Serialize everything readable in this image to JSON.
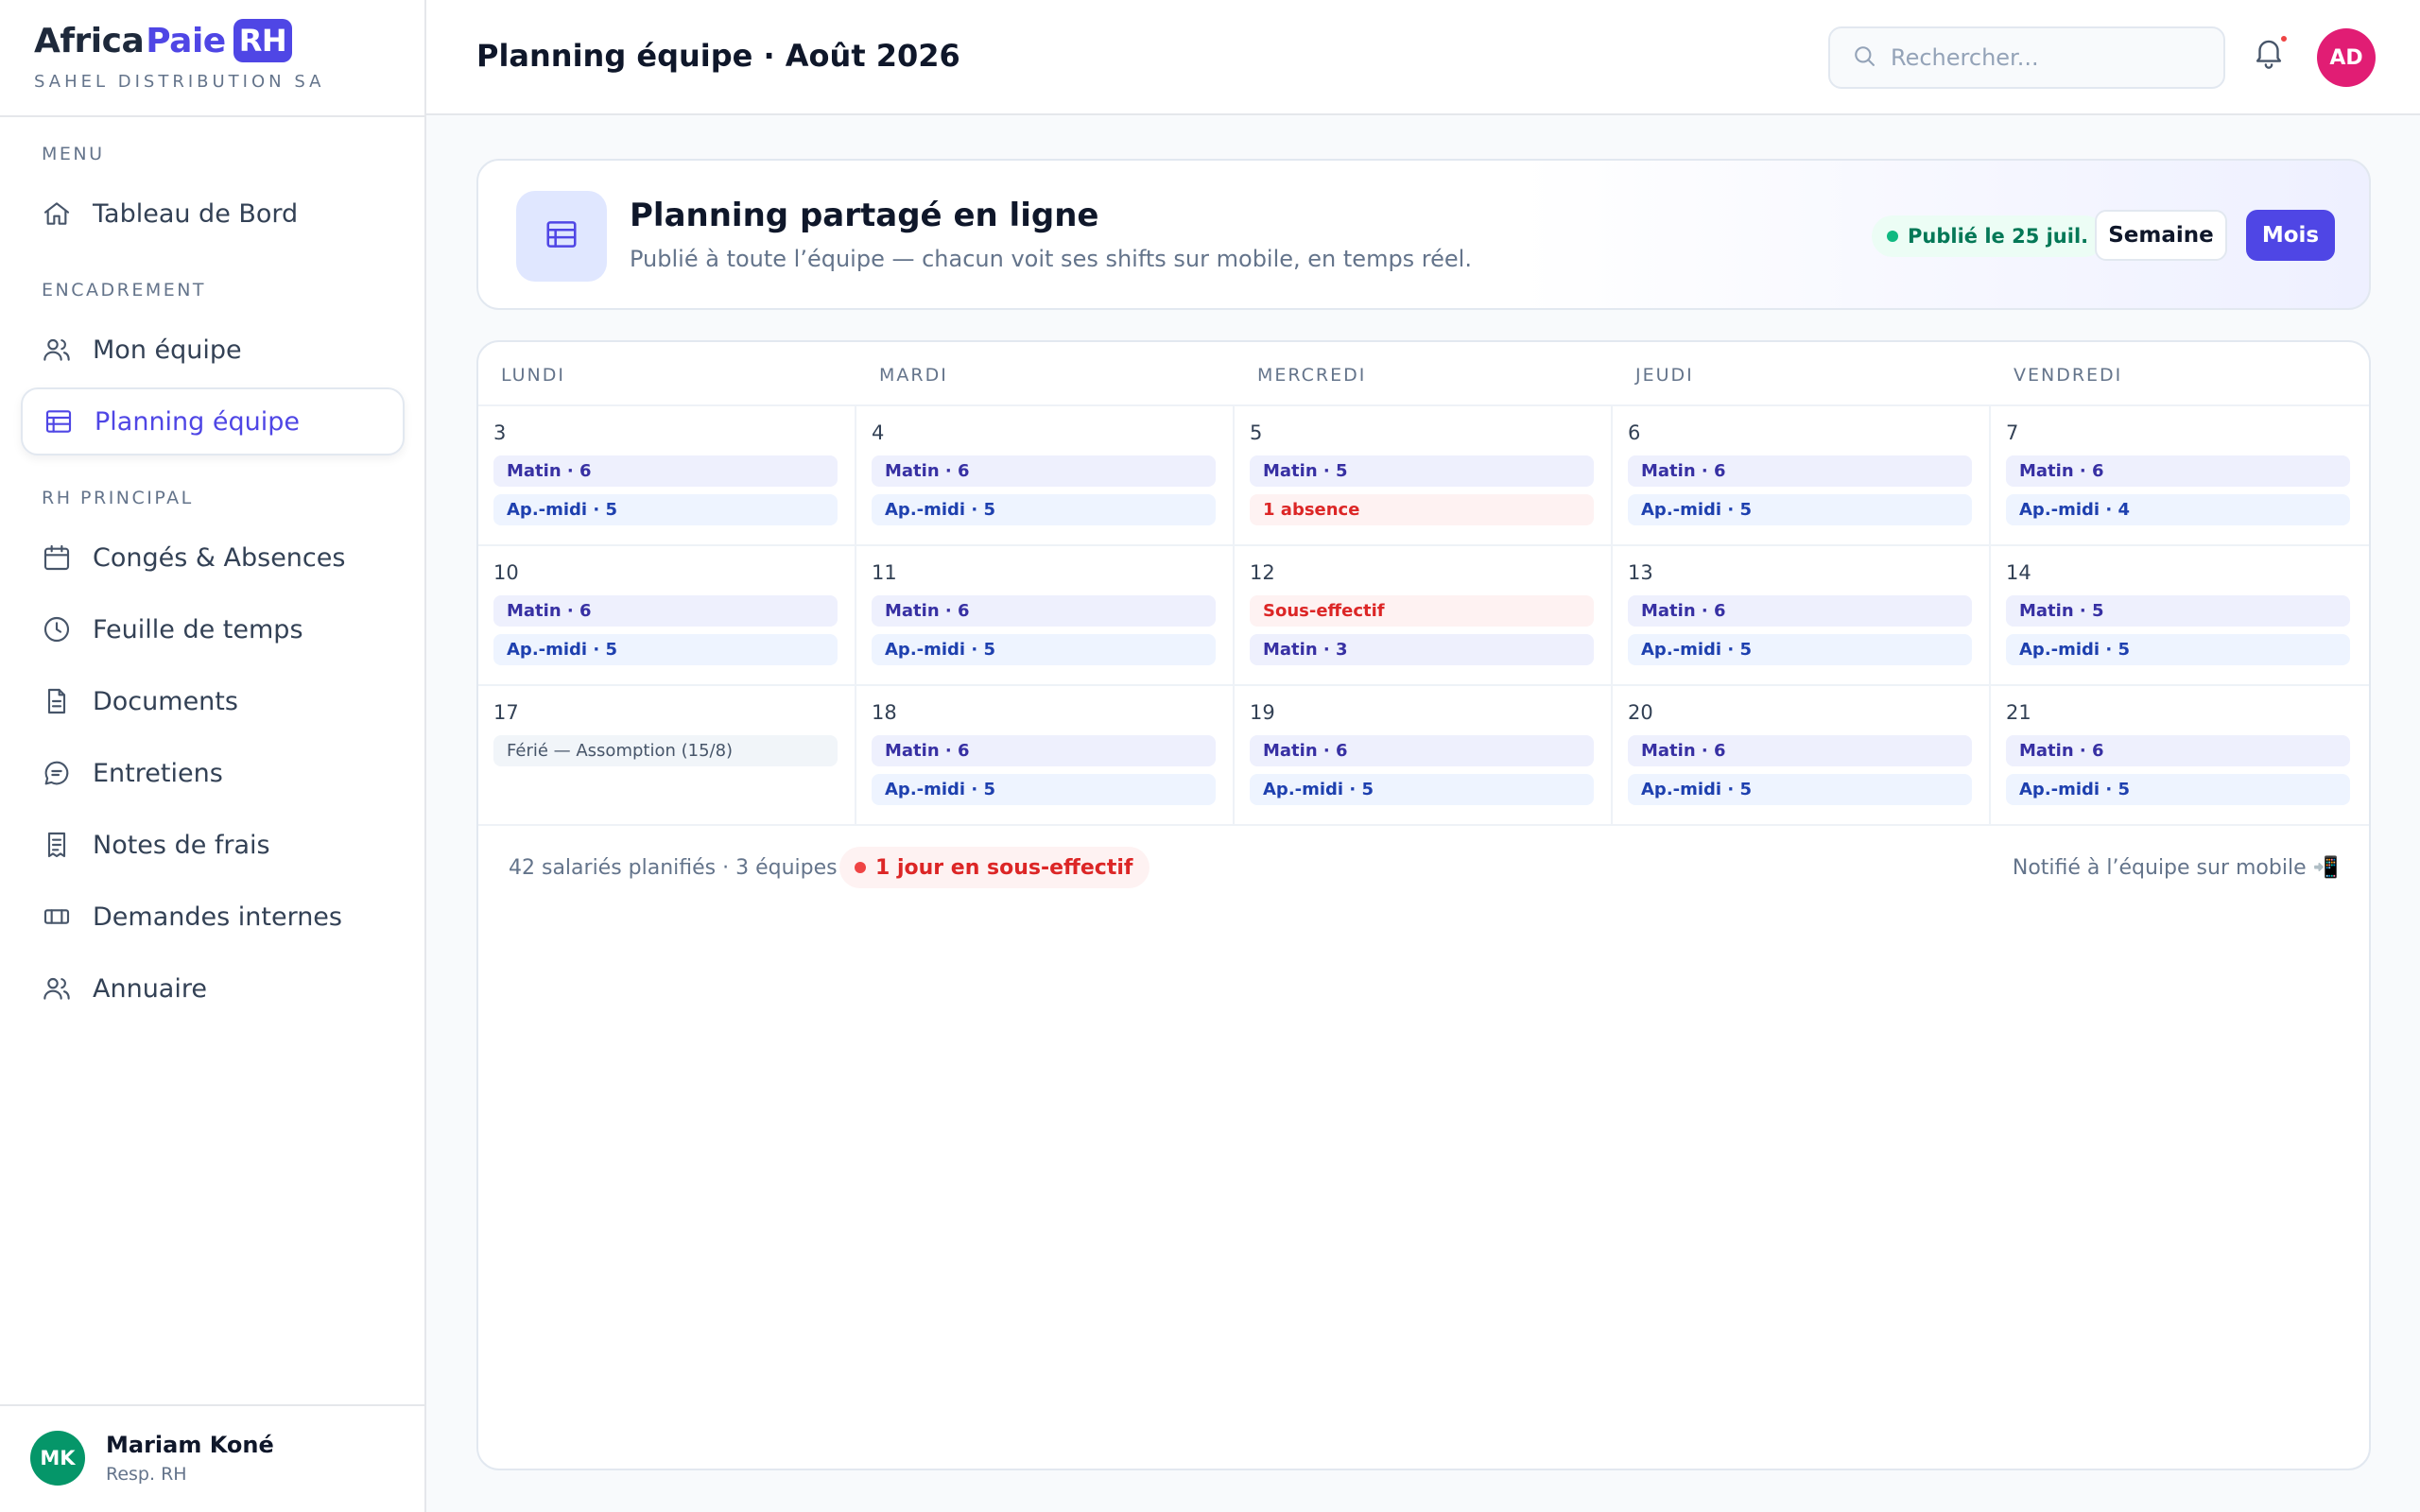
{
  "brand": {
    "africa": "Africa",
    "paie": "Paie",
    "rh": "RH",
    "company": "SAHEL DISTRIBUTION SA"
  },
  "sidebar": {
    "sections": {
      "menu": "MENU",
      "encadrement": "ENCADREMENT",
      "rh_principal": "RH PRINCIPAL"
    },
    "items": [
      {
        "label": "Tableau de Bord",
        "icon": "home-icon"
      },
      {
        "label": "Mon équipe",
        "icon": "users-icon"
      },
      {
        "label": "Planning équipe",
        "icon": "table-icon",
        "active": true
      },
      {
        "label": "Congés & Absences",
        "icon": "calendar-icon"
      },
      {
        "label": "Feuille de temps",
        "icon": "clock-icon"
      },
      {
        "label": "Documents",
        "icon": "file-icon"
      },
      {
        "label": "Entretiens",
        "icon": "chat-icon"
      },
      {
        "label": "Notes de frais",
        "icon": "receipt-icon"
      },
      {
        "label": "Demandes internes",
        "icon": "ticket-icon"
      },
      {
        "label": "Annuaire",
        "icon": "users-icon"
      }
    ],
    "user": {
      "initials": "MK",
      "name": "Mariam Koné",
      "role": "Resp. RH"
    }
  },
  "header": {
    "title": "Planning équipe · Août 2026",
    "search_placeholder": "Rechercher...",
    "avatar_initials": "AD"
  },
  "banner": {
    "title": "Planning partagé en ligne",
    "subtitle": "Publié à toute l’équipe — chacun voit ses shifts sur mobile, en temps réel.",
    "status": "Publié le 25 juil.",
    "week_label": "Semaine",
    "month_label": "Mois"
  },
  "calendar": {
    "day_names": [
      "LUNDI",
      "MARDI",
      "MERCREDI",
      "JEUDI",
      "VENDREDI"
    ],
    "weeks": [
      [
        {
          "date": "3",
          "chips": [
            {
              "text": "Matin · 6",
              "kind": "morning"
            },
            {
              "text": "Ap.-midi · 5",
              "kind": "afternoon"
            }
          ]
        },
        {
          "date": "4",
          "chips": [
            {
              "text": "Matin · 6",
              "kind": "morning"
            },
            {
              "text": "Ap.-midi · 5",
              "kind": "afternoon"
            }
          ]
        },
        {
          "date": "5",
          "chips": [
            {
              "text": "Matin · 5",
              "kind": "morning"
            },
            {
              "text": "1 absence",
              "kind": "alert"
            }
          ]
        },
        {
          "date": "6",
          "chips": [
            {
              "text": "Matin · 6",
              "kind": "morning"
            },
            {
              "text": "Ap.-midi · 5",
              "kind": "afternoon"
            }
          ]
        },
        {
          "date": "7",
          "chips": [
            {
              "text": "Matin · 6",
              "kind": "morning"
            },
            {
              "text": "Ap.-midi · 4",
              "kind": "afternoon"
            }
          ]
        }
      ],
      [
        {
          "date": "10",
          "chips": [
            {
              "text": "Matin · 6",
              "kind": "morning"
            },
            {
              "text": "Ap.-midi · 5",
              "kind": "afternoon"
            }
          ]
        },
        {
          "date": "11",
          "chips": [
            {
              "text": "Matin · 6",
              "kind": "morning"
            },
            {
              "text": "Ap.-midi · 5",
              "kind": "afternoon"
            }
          ]
        },
        {
          "date": "12",
          "chips": [
            {
              "text": "Sous-effectif",
              "kind": "alert"
            },
            {
              "text": "Matin · 3",
              "kind": "morning"
            }
          ]
        },
        {
          "date": "13",
          "chips": [
            {
              "text": "Matin · 6",
              "kind": "morning"
            },
            {
              "text": "Ap.-midi · 5",
              "kind": "afternoon"
            }
          ]
        },
        {
          "date": "14",
          "chips": [
            {
              "text": "Matin · 5",
              "kind": "morning"
            },
            {
              "text": "Ap.-midi · 5",
              "kind": "afternoon"
            }
          ]
        }
      ],
      [
        {
          "date": "17",
          "chips": [
            {
              "text": "Férié — Assomption (15/8)",
              "kind": "holiday"
            }
          ]
        },
        {
          "date": "18",
          "chips": [
            {
              "text": "Matin · 6",
              "kind": "morning"
            },
            {
              "text": "Ap.-midi · 5",
              "kind": "afternoon"
            }
          ]
        },
        {
          "date": "19",
          "chips": [
            {
              "text": "Matin · 6",
              "kind": "morning"
            },
            {
              "text": "Ap.-midi · 5",
              "kind": "afternoon"
            }
          ]
        },
        {
          "date": "20",
          "chips": [
            {
              "text": "Matin · 6",
              "kind": "morning"
            },
            {
              "text": "Ap.-midi · 5",
              "kind": "afternoon"
            }
          ]
        },
        {
          "date": "21",
          "chips": [
            {
              "text": "Matin · 6",
              "kind": "morning"
            },
            {
              "text": "Ap.-midi · 5",
              "kind": "afternoon"
            }
          ]
        }
      ]
    ],
    "footer": {
      "stats": "42 salariés planifiés · 3 équipes",
      "alert": "1 jour en sous-effectif",
      "notify": "Notifié à l’équipe sur mobile 📲"
    }
  },
  "colors": {
    "accent": "#4f46e5",
    "success": "#047857",
    "danger": "#dc2626"
  }
}
